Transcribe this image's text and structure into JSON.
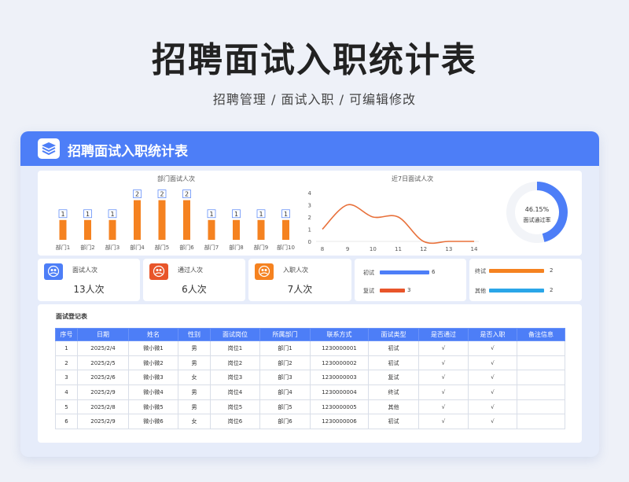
{
  "page": {
    "title": "招聘面试入职统计表",
    "subtitle": "招聘管理 /  面试入职 /  可编辑修改"
  },
  "header": {
    "title": "招聘面试入职统计表",
    "icon": "layers-icon",
    "color": "#4d7ef7"
  },
  "chart_data": [
    {
      "type": "bar",
      "title": "部门面试人次",
      "categories": [
        "部门1",
        "部门2",
        "部门3",
        "部门4",
        "部门5",
        "部门6",
        "部门7",
        "部门8",
        "部门9",
        "部门10"
      ],
      "values": [
        1,
        1,
        1,
        2,
        2,
        2,
        1,
        1,
        1,
        1
      ],
      "ylim": [
        0,
        2.3
      ],
      "color": "#f58220"
    },
    {
      "type": "line",
      "title": "近7日面试人次",
      "x": [
        8,
        9,
        10,
        11,
        12,
        13,
        14
      ],
      "y": [
        1,
        3,
        2,
        2,
        0,
        0,
        0
      ],
      "xlim": [
        8,
        14
      ],
      "ylim": [
        0,
        4
      ],
      "yticks": [
        0,
        1,
        2,
        3,
        4
      ],
      "color": "#e8703a"
    },
    {
      "type": "pie",
      "title": "面试通过率",
      "values": [
        46.15,
        53.85
      ],
      "value_label": "46.15%",
      "colors": [
        "#4d7ef7",
        "#f2f4f8"
      ]
    }
  ],
  "kpis": [
    {
      "label": "面试人次",
      "value": "13人次",
      "icon": "users-icon",
      "color": "#4d7ef7"
    },
    {
      "label": "通过人次",
      "value": "6人次",
      "icon": "user-check-icon",
      "color": "#e8552a"
    },
    {
      "label": "入职人次",
      "value": "7人次",
      "icon": "user-add-icon",
      "color": "#f58220"
    }
  ],
  "interview_types": [
    {
      "label": "初试",
      "value": 6,
      "color": "#4d7ef7"
    },
    {
      "label": "复试",
      "value": 3,
      "color": "#e8552a"
    },
    {
      "label": "终试",
      "value": 2,
      "color": "#f58220"
    },
    {
      "label": "其他",
      "value": 2,
      "color": "#2aa6e8"
    }
  ],
  "table": {
    "title": "面试登记表",
    "columns": [
      "序号",
      "日期",
      "姓名",
      "性别",
      "面试岗位",
      "所属部门",
      "联系方式",
      "面试类型",
      "是否通过",
      "是否入职",
      "备注信息"
    ],
    "rows": [
      [
        "1",
        "2025/2/4",
        "微小微1",
        "男",
        "岗位1",
        "部门1",
        "1230000001",
        "初试",
        "√",
        "√",
        ""
      ],
      [
        "2",
        "2025/2/5",
        "微小微2",
        "男",
        "岗位2",
        "部门2",
        "1230000002",
        "初试",
        "√",
        "√",
        ""
      ],
      [
        "3",
        "2025/2/6",
        "微小微3",
        "女",
        "岗位3",
        "部门3",
        "1230000003",
        "复试",
        "√",
        "√",
        ""
      ],
      [
        "4",
        "2025/2/9",
        "微小微4",
        "男",
        "岗位4",
        "部门4",
        "1230000004",
        "终试",
        "√",
        "√",
        ""
      ],
      [
        "5",
        "2025/2/8",
        "微小微5",
        "男",
        "岗位5",
        "部门5",
        "1230000005",
        "其他",
        "√",
        "√",
        ""
      ],
      [
        "6",
        "2025/2/9",
        "微小微6",
        "女",
        "岗位6",
        "部门6",
        "1230000006",
        "初试",
        "√",
        "√",
        ""
      ]
    ]
  }
}
